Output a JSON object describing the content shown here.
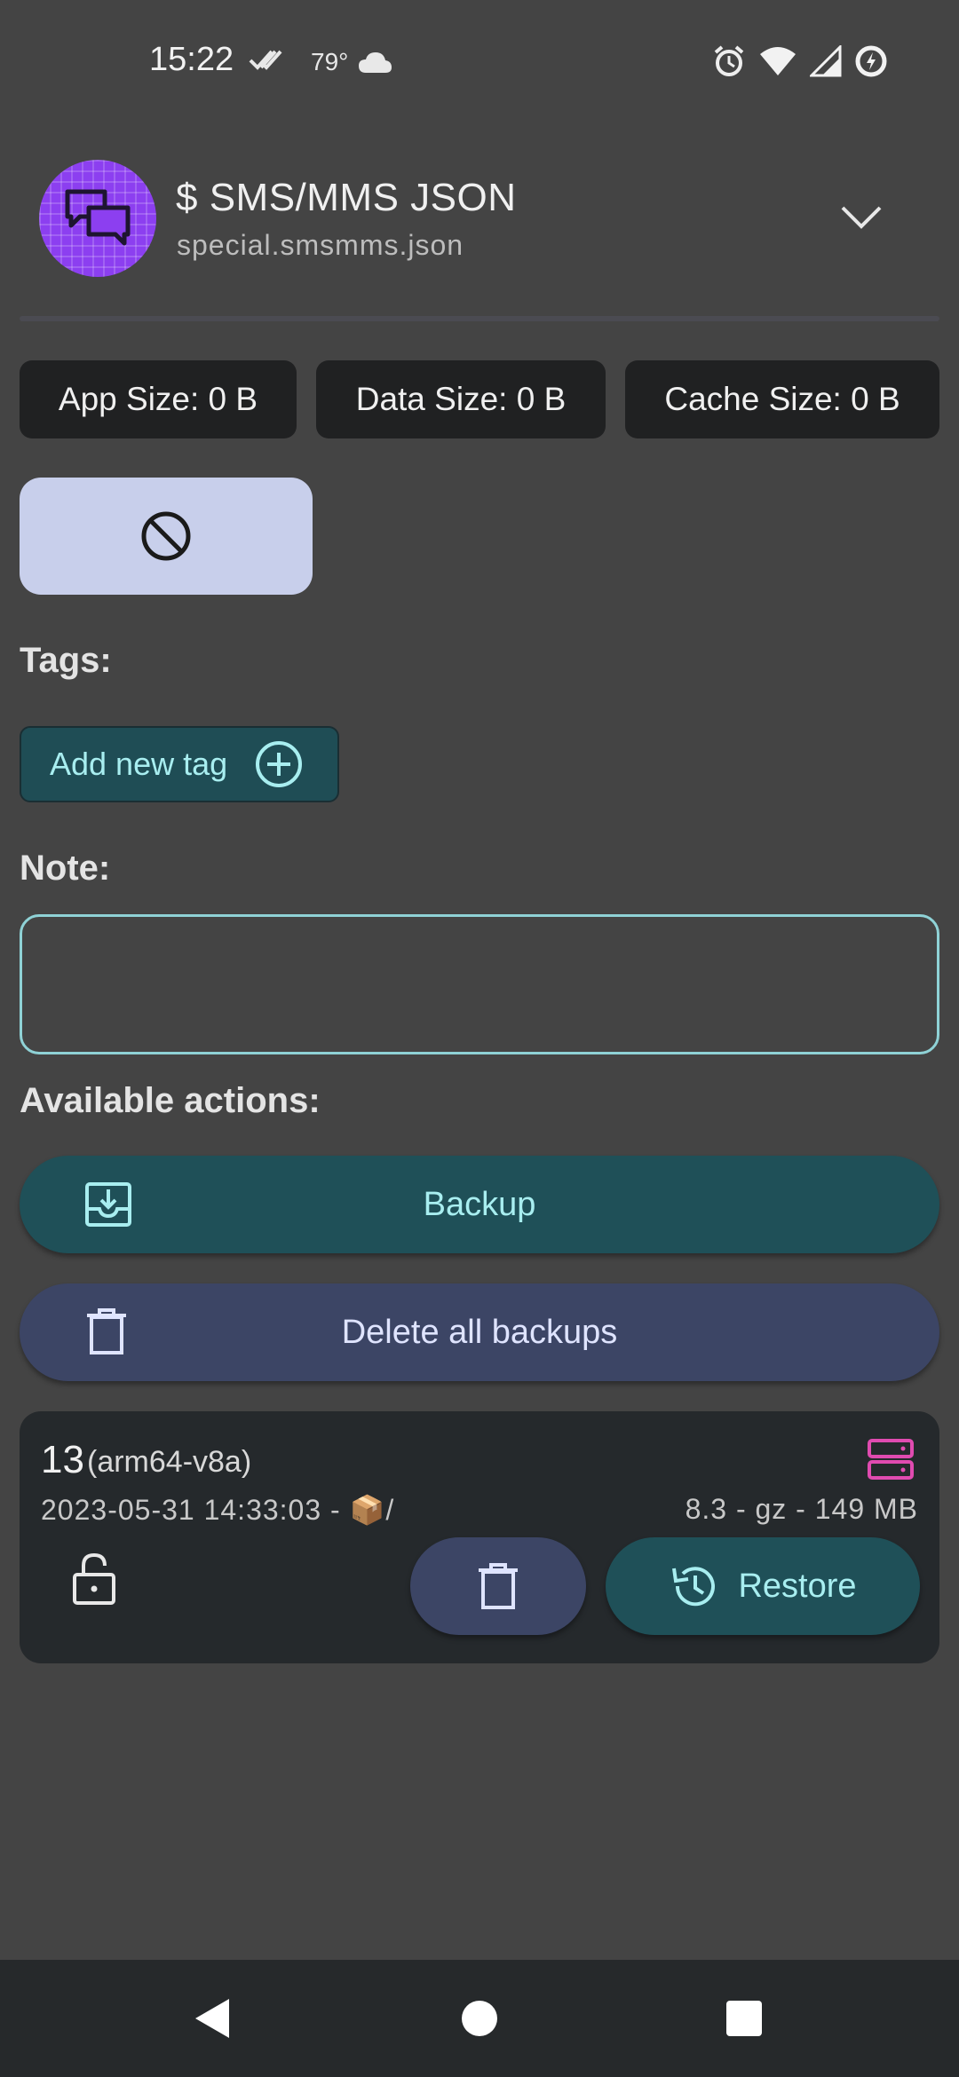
{
  "status_bar": {
    "time": "15:22",
    "temperature": "79°",
    "icons": [
      "done-all-icon",
      "cloud-icon",
      "alarm-icon",
      "wifi-icon",
      "signal-icon",
      "data-saver-icon"
    ]
  },
  "header": {
    "app_icon": "chat-bubbles-icon",
    "title": "$ SMS/MMS JSON",
    "package": "special.smsmms.json",
    "expand_icon": "chevron-down-icon"
  },
  "sizes": {
    "app": "App Size: 0 B",
    "data": "Data Size: 0 B",
    "cache": "Cache Size: 0 B"
  },
  "block_button": {
    "icon": "block-icon"
  },
  "tags": {
    "label": "Tags:",
    "add_button": "Add new tag"
  },
  "note": {
    "label": "Note:",
    "value": "",
    "placeholder": ""
  },
  "actions": {
    "label": "Available actions:",
    "backup": "Backup",
    "delete_all": "Delete all backups"
  },
  "backup_item": {
    "version": "13",
    "abi": "(arm64-v8a)",
    "date": "2023-05-31 14:33:03 - 📦/",
    "details": "8.3 - gz - 149 MB",
    "restore": "Restore"
  },
  "colors": {
    "background": "#444444",
    "accent_teal": "#1f5058",
    "accent_text": "#a8eef0",
    "secondary_button": "#3c4565",
    "server_icon": "#e04bb0",
    "app_icon_bg": "#8c3ff0"
  }
}
